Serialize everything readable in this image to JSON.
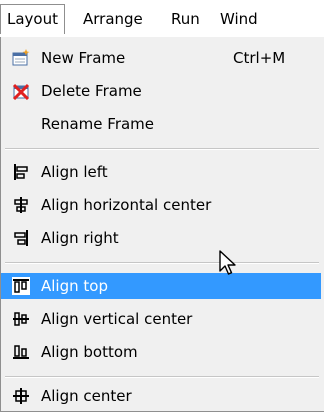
{
  "menubar": {
    "items": [
      {
        "label": "Layout"
      },
      {
        "label": "Arrange"
      },
      {
        "label": "Run"
      },
      {
        "label": "Wind"
      }
    ]
  },
  "menu": {
    "new_frame": {
      "label": "New Frame",
      "shortcut": "Ctrl+M",
      "icon": "new-frame-icon"
    },
    "delete_frame": {
      "label": "Delete Frame",
      "icon": "delete-frame-icon"
    },
    "rename_frame": {
      "label": "Rename Frame"
    },
    "align_left": {
      "label": "Align left",
      "icon": "align-left-icon"
    },
    "align_hcenter": {
      "label": "Align horizontal center",
      "icon": "align-horizontal-center-icon"
    },
    "align_right": {
      "label": "Align right",
      "icon": "align-right-icon"
    },
    "align_top": {
      "label": "Align top",
      "icon": "align-top-icon",
      "highlighted": true
    },
    "align_vcenter": {
      "label": "Align vertical center",
      "icon": "align-vertical-center-icon"
    },
    "align_bottom": {
      "label": "Align bottom",
      "icon": "align-bottom-icon"
    },
    "align_center": {
      "label": "Align center",
      "icon": "align-center-icon"
    }
  },
  "colors": {
    "highlight": "#3399ff",
    "menu_background": "#f0f0f0",
    "delete_icon_red": "#e02020",
    "new_icon_orange": "#f0a020"
  }
}
